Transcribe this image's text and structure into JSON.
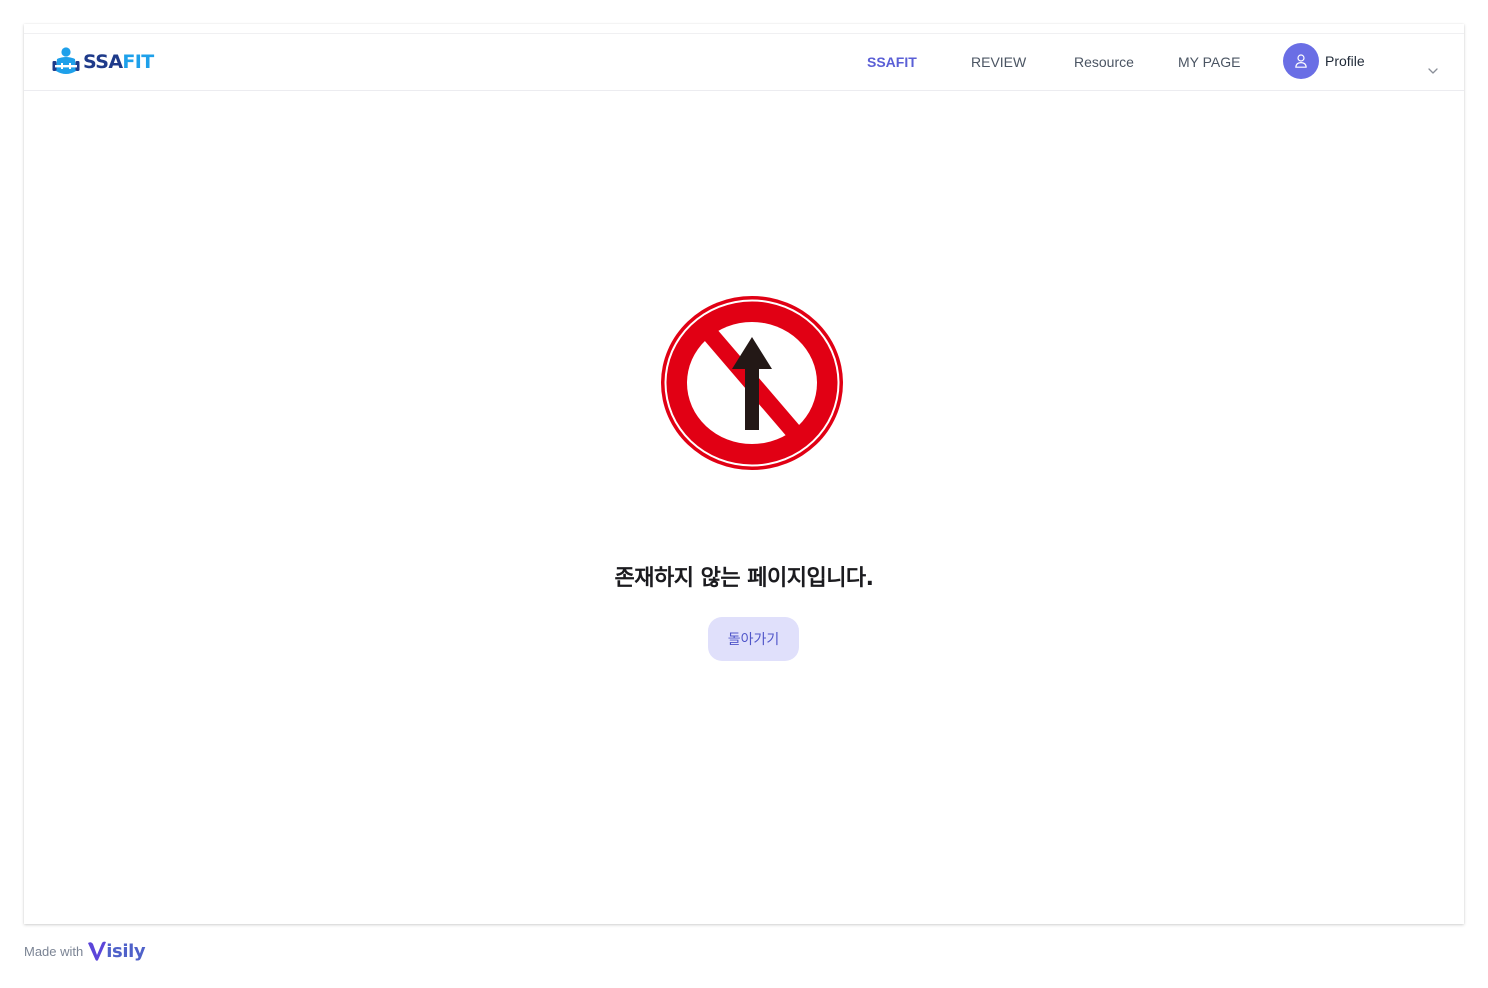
{
  "brand": {
    "logo_part1": "SSA",
    "logo_part2": "FIT",
    "logo_icon": "dumbbell-person-icon",
    "colors": {
      "dark": "#1e3a8a",
      "light": "#1ea0ea"
    }
  },
  "nav": {
    "items": [
      {
        "label": "SSAFIT",
        "active": true
      },
      {
        "label": "REVIEW",
        "active": false
      },
      {
        "label": "Resource",
        "active": false
      },
      {
        "label": "MY PAGE",
        "active": false
      }
    ],
    "active_color": "#5a5fd6"
  },
  "profile": {
    "name": "Profile",
    "avatar_icon": "user-icon",
    "avatar_color": "#6a6ee5",
    "dropdown_icon": "chevron-down-icon"
  },
  "error": {
    "sign_icon": "no-entry-sign-icon",
    "message": "존재하지 않는 페이지입니다.",
    "back_button": "돌아가기"
  },
  "footer": {
    "made_with": "Made with",
    "brand": "isily",
    "brand_icon": "visily-v-icon"
  }
}
